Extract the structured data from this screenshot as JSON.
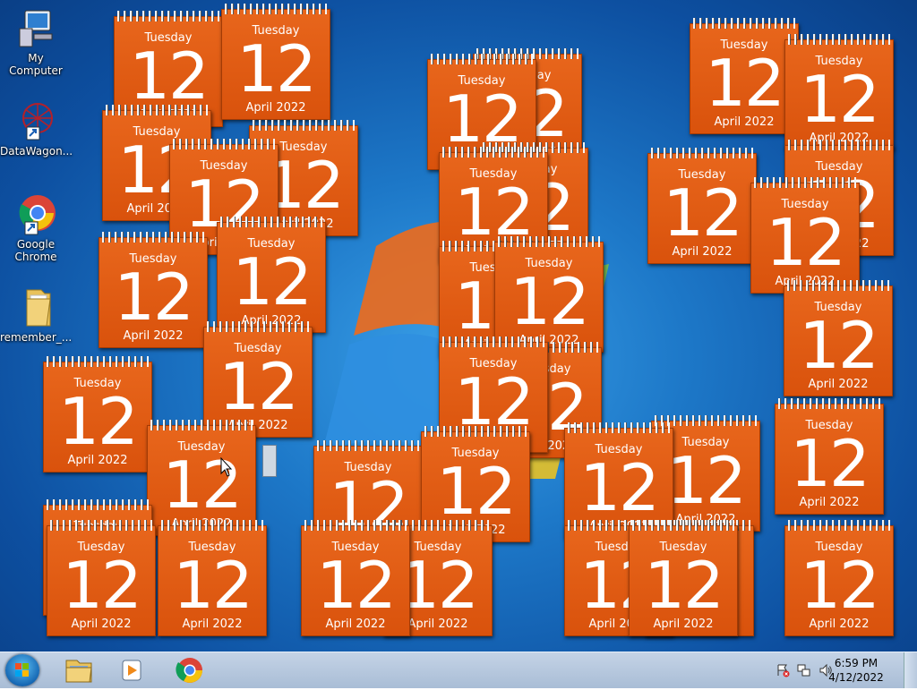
{
  "desktop_icons": [
    {
      "label": "My Computer",
      "icon": "computer-icon"
    },
    {
      "label": "DataWagon...",
      "icon": "network-shortcut-icon"
    },
    {
      "label": "Google Chrome",
      "icon": "chrome-icon"
    },
    {
      "label": "remember_...",
      "icon": "folder-icon"
    }
  ],
  "calendar": {
    "weekday": "Tuesday",
    "day": "12",
    "month_year": "April 2022"
  },
  "taskbar": {
    "pinned": [
      {
        "name": "explorer",
        "icon": "folder-icon"
      },
      {
        "name": "media-player",
        "icon": "media-player-icon"
      },
      {
        "name": "chrome",
        "icon": "chrome-icon"
      }
    ],
    "tray_icons": [
      "action-center-icon",
      "network-icon",
      "volume-icon"
    ],
    "clock_time": "6:59 PM",
    "clock_date": "4/12/2022"
  },
  "colors": {
    "calendar_orange": "#e0581a",
    "desktop_blue": "#1d78c8"
  }
}
